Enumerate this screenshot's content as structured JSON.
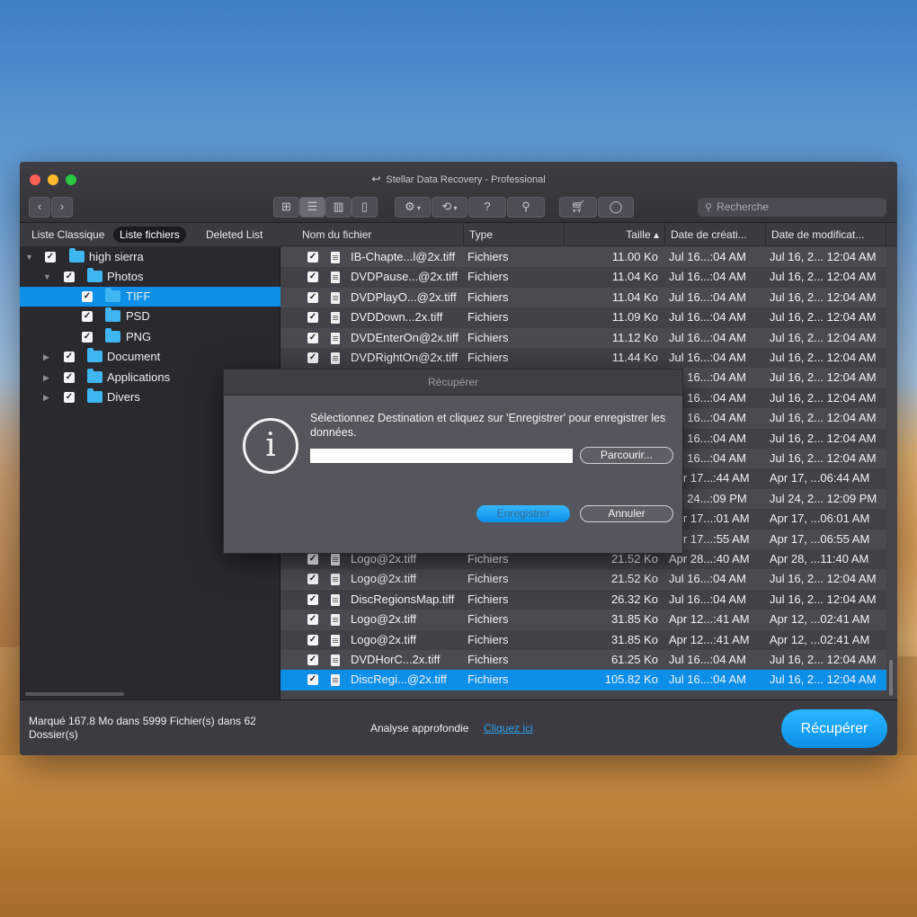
{
  "window": {
    "title": "Stellar Data Recovery - Professional"
  },
  "toolbar": {
    "back_icon": "chevron-left-icon",
    "forward_icon": "chevron-right-icon",
    "view_icons": [
      "grid-view-icon",
      "list-view-icon",
      "column-view-icon",
      "coverflow-view-icon"
    ],
    "search_placeholder": "Recherche"
  },
  "sidebar": {
    "tabs": [
      "Liste Classique",
      "Liste fichiers",
      "Deleted List"
    ],
    "active_tab": "Liste fichiers",
    "tree": [
      {
        "label": "high sierra",
        "expanded": true
      },
      {
        "label": "Photos",
        "expanded": true
      },
      {
        "label": "TIFF",
        "selected": true
      },
      {
        "label": "PSD"
      },
      {
        "label": "PNG"
      },
      {
        "label": "Document",
        "expanded": false
      },
      {
        "label": "Applications",
        "expanded": false
      },
      {
        "label": "Divers",
        "expanded": false
      }
    ]
  },
  "table": {
    "columns": [
      "Nom du fichier",
      "Type",
      "Taille ▴",
      "Date de créati...",
      "Date de modificat..."
    ],
    "rows": [
      {
        "name": "IB-Chapte...l@2x.tiff",
        "type": "Fichiers",
        "size": "11.00 Ko",
        "created": "Jul 16...:04 AM",
        "modified": "Jul 16, 2... 12:04 AM"
      },
      {
        "name": "DVDPause...@2x.tiff",
        "type": "Fichiers",
        "size": "11.04 Ko",
        "created": "Jul 16...:04 AM",
        "modified": "Jul 16, 2... 12:04 AM"
      },
      {
        "name": "DVDPlayO...@2x.tiff",
        "type": "Fichiers",
        "size": "11.04 Ko",
        "created": "Jul 16...:04 AM",
        "modified": "Jul 16, 2... 12:04 AM"
      },
      {
        "name": "DVDDown...2x.tiff",
        "type": "Fichiers",
        "size": "11.09 Ko",
        "created": "Jul 16...:04 AM",
        "modified": "Jul 16, 2... 12:04 AM"
      },
      {
        "name": "DVDEnterOn@2x.tiff",
        "type": "Fichiers",
        "size": "11.12 Ko",
        "created": "Jul 16...:04 AM",
        "modified": "Jul 16, 2... 12:04 AM"
      },
      {
        "name": "DVDRightOn@2x.tiff",
        "type": "Fichiers",
        "size": "11.44 Ko",
        "created": "Jul 16...:04 AM",
        "modified": "Jul 16, 2... 12:04 AM"
      },
      {
        "name": "",
        "type": "",
        "size": "",
        "created": "Jul 16...:04 AM",
        "modified": "Jul 16, 2... 12:04 AM"
      },
      {
        "name": "",
        "type": "",
        "size": "",
        "created": "Jul 16...:04 AM",
        "modified": "Jul 16, 2... 12:04 AM"
      },
      {
        "name": "",
        "type": "",
        "size": "",
        "created": "Jul 16...:04 AM",
        "modified": "Jul 16, 2... 12:04 AM"
      },
      {
        "name": "",
        "type": "",
        "size": "",
        "created": "Jul 16...:04 AM",
        "modified": "Jul 16, 2... 12:04 AM"
      },
      {
        "name": "",
        "type": "",
        "size": "",
        "created": "Jul 16...:04 AM",
        "modified": "Jul 16, 2... 12:04 AM"
      },
      {
        "name": "",
        "type": "",
        "size": "",
        "created": "Apr 17...:44 AM",
        "modified": "Apr 17, ...06:44 AM"
      },
      {
        "name": "",
        "type": "",
        "size": "",
        "created": "Jul 24...:09 PM",
        "modified": "Jul 24, 2... 12:09 PM"
      },
      {
        "name": "",
        "type": "",
        "size": "",
        "created": "Apr 17...:01 AM",
        "modified": "Apr 17, ...06:01 AM"
      },
      {
        "name": "",
        "type": "",
        "size": "",
        "created": "Apr 17...:55 AM",
        "modified": "Apr 17, ...06:55 AM"
      },
      {
        "name": "Logo@2x.tiff",
        "type": "Fichiers",
        "size": "21.52 Ko",
        "created": "Apr 28...:40 AM",
        "modified": "Apr 28, ...11:40 AM"
      },
      {
        "name": "Logo@2x.tiff",
        "type": "Fichiers",
        "size": "21.52 Ko",
        "created": "Jul 16...:04 AM",
        "modified": "Jul 16, 2... 12:04 AM"
      },
      {
        "name": "DiscRegionsMap.tiff",
        "type": "Fichiers",
        "size": "26.32 Ko",
        "created": "Jul 16...:04 AM",
        "modified": "Jul 16, 2... 12:04 AM"
      },
      {
        "name": "Logo@2x.tiff",
        "type": "Fichiers",
        "size": "31.85 Ko",
        "created": "Apr 12...:41 AM",
        "modified": "Apr 12, ...02:41 AM"
      },
      {
        "name": "Logo@2x.tiff",
        "type": "Fichiers",
        "size": "31.85 Ko",
        "created": "Apr 12...:41 AM",
        "modified": "Apr 12, ...02:41 AM"
      },
      {
        "name": "DVDHorC...2x.tiff",
        "type": "Fichiers",
        "size": "61.25 Ko",
        "created": "Jul 16...:04 AM",
        "modified": "Jul 16, 2... 12:04 AM"
      },
      {
        "name": "DiscRegi...@2x.tiff",
        "type": "Fichiers",
        "size": "105.82 Ko",
        "created": "Jul 16...:04 AM",
        "modified": "Jul 16, 2... 12:04 AM",
        "selected": true
      }
    ]
  },
  "footer": {
    "marked_text": "Marqué 167.8 Mo dans 5999  Fichier(s) dans 62 Dossier(s)",
    "deep_scan_label": "Analyse approfondie",
    "deep_scan_link": "Cliquez ici",
    "recover_button": "Récupérer"
  },
  "dialog": {
    "title": "Récupérer",
    "message": "Sélectionnez Destination et cliquez sur 'Enregistrer' pour enregistrer les données.",
    "destination_value": "",
    "browse_button": "Parcourir...",
    "save_button": "Enregistrer",
    "cancel_button": "Annuler"
  }
}
